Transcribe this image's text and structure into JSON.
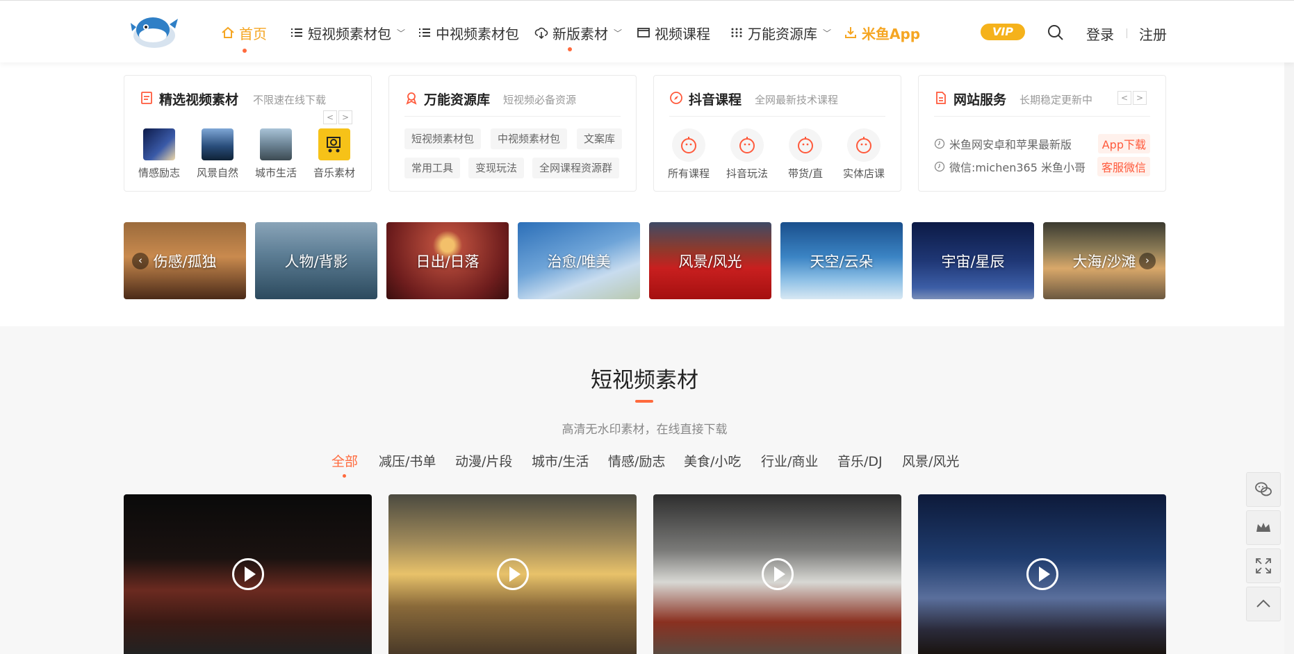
{
  "colors": {
    "accent": "#f5a623",
    "brand_red": "#ff6a3d",
    "vip": "#f5b21b"
  },
  "header": {
    "logo_icon": "pufferfish-logo-icon",
    "nav": [
      {
        "label": "首页",
        "icon": "home-icon",
        "active": true
      },
      {
        "label": "短视频素材包",
        "icon": "list-icon",
        "caret": true
      },
      {
        "label": "中视频素材包",
        "icon": "list-icon"
      },
      {
        "label": "新版素材",
        "icon": "cloud-icon",
        "caret": true
      },
      {
        "label": "视频课程",
        "icon": "video-icon"
      },
      {
        "label": "万能资源库",
        "icon": "grid-icon",
        "caret": true
      },
      {
        "label": "米鱼App",
        "icon": "download-icon"
      }
    ],
    "vip": "VIP",
    "login": "登录",
    "register": "注册"
  },
  "cards": {
    "materials": {
      "title": "精选视频素材",
      "subtitle": "不限速在线下载",
      "items": [
        {
          "label": "情感励志"
        },
        {
          "label": "风景自然"
        },
        {
          "label": "城市生活"
        },
        {
          "label": "音乐素材"
        }
      ]
    },
    "resources": {
      "title": "万能资源库",
      "subtitle": "短视频必备资源",
      "tags": [
        "短视频素材包",
        "中视频素材包",
        "文案库",
        "常用工具",
        "变现玩法",
        "全网课程资源群"
      ]
    },
    "courses": {
      "title": "抖音课程",
      "subtitle": "全网最新技术课程",
      "items": [
        {
          "label": "所有课程"
        },
        {
          "label": "抖音玩法"
        },
        {
          "label": "带货/直"
        },
        {
          "label": "实体店课"
        }
      ]
    },
    "services": {
      "title": "网站服务",
      "subtitle": "长期稳定更新中",
      "rows": [
        {
          "text": "米鱼网安卓和苹果最新版",
          "button": "App下载"
        },
        {
          "text": "微信:michen365 米鱼小哥",
          "button": "客服微信"
        }
      ]
    }
  },
  "banners": [
    "伤感/孤独",
    "人物/背影",
    "日出/日落",
    "治愈/唯美",
    "风景/风光",
    "天空/云朵",
    "宇宙/星辰",
    "大海/沙滩"
  ],
  "section": {
    "title": "短视频素材",
    "subtitle": "高清无水印素材，在线直接下载",
    "filters": [
      "全部",
      "减压/书单",
      "动漫/片段",
      "城市/生活",
      "情感/励志",
      "美食/小吃",
      "行业/商业",
      "音乐/DJ",
      "风景/风光"
    ],
    "active_filter": "全部"
  },
  "side_tools": [
    "wechat-icon",
    "crown-icon",
    "fullscreen-icon",
    "back-to-top-icon"
  ]
}
